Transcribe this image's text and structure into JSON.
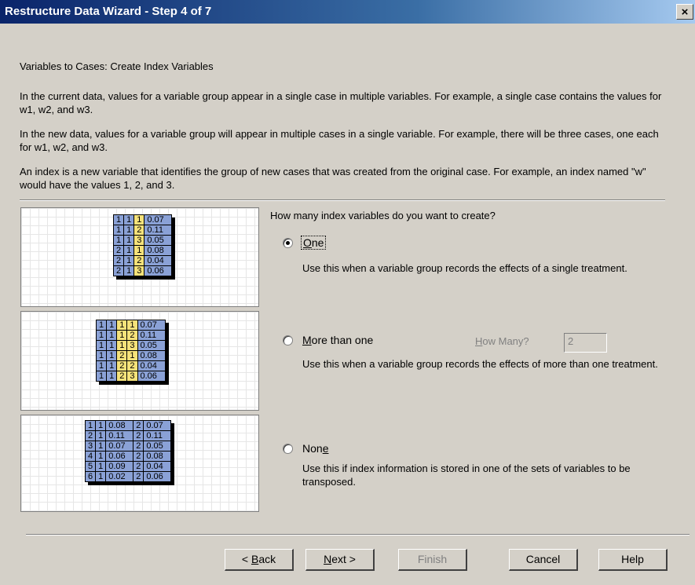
{
  "window": {
    "title": "Restructure Data Wizard - Step 4 of 7",
    "close_label": "×"
  },
  "heading": "Variables to Cases: Create Index Variables",
  "paragraphs": [
    "In the current data, values for a variable group appear in a single case in multiple variables.  For example, a single case contains the values for w1, w2, and w3.",
    "In the new data, values for a variable group will appear in multiple cases in a single variable.  For example, there will be three cases, one each for w1, w2, and w3.",
    "An index is a new variable that identifies the group of new cases that was created from the original case.  For example, an index named \"w\" would have the values 1, 2, and 3."
  ],
  "question": "How many index variables do you want to create?",
  "options": [
    {
      "label": "One",
      "mnemonic": "O",
      "rest": "ne",
      "checked": true,
      "description": "Use this when a variable group records the effects of a single treatment."
    },
    {
      "label": "More than one",
      "mnemonic": "M",
      "rest": "ore than one",
      "checked": false,
      "description": "Use this when a variable group records the effects of more than one treatment."
    },
    {
      "label": "None",
      "pre": "Non",
      "mnemonic": "e",
      "checked": false,
      "description": "Use this if index information is stored in one of the sets of variables to be transposed."
    }
  ],
  "how_many": {
    "label_mnemonic": "H",
    "label_rest": "ow Many?",
    "value": "2"
  },
  "diagram1": [
    [
      "1",
      "1",
      "1",
      "0.07"
    ],
    [
      "1",
      "1",
      "2",
      "0.11"
    ],
    [
      "1",
      "1",
      "3",
      "0.05"
    ],
    [
      "2",
      "1",
      "1",
      "0.08"
    ],
    [
      "2",
      "1",
      "2",
      "0.04"
    ],
    [
      "2",
      "1",
      "3",
      "0.06"
    ]
  ],
  "diagram2": [
    [
      "1",
      "1",
      "1",
      "1",
      "0.07"
    ],
    [
      "1",
      "1",
      "1",
      "2",
      "0.11"
    ],
    [
      "1",
      "1",
      "1",
      "3",
      "0.05"
    ],
    [
      "1",
      "1",
      "2",
      "1",
      "0.08"
    ],
    [
      "1",
      "1",
      "2",
      "2",
      "0.04"
    ],
    [
      "1",
      "1",
      "2",
      "3",
      "0.06"
    ]
  ],
  "diagram3": [
    [
      "1",
      "1",
      "0.08",
      "2",
      "0.07"
    ],
    [
      "2",
      "1",
      "0.11",
      "2",
      "0.11"
    ],
    [
      "3",
      "1",
      "0.07",
      "2",
      "0.05"
    ],
    [
      "4",
      "1",
      "0.06",
      "2",
      "0.08"
    ],
    [
      "5",
      "1",
      "0.09",
      "2",
      "0.04"
    ],
    [
      "6",
      "1",
      "0.02",
      "2",
      "0.06"
    ]
  ],
  "buttons": {
    "back": {
      "prefix": "< ",
      "mnemonic": "B",
      "rest": "ack"
    },
    "next": {
      "mnemonic": "N",
      "rest": "ext >"
    },
    "finish": "Finish",
    "cancel": "Cancel",
    "help": "Help"
  },
  "colors": {
    "blue_cell": "#8aa1d6",
    "yellow_cell": "#f5e27a",
    "dialog_bg": "#d4d0c8",
    "title_bar": "#0a246a"
  }
}
